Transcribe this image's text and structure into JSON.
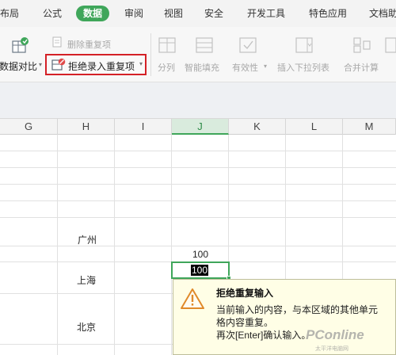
{
  "tabs": [
    "布局",
    "公式",
    "数据",
    "审阅",
    "视图",
    "安全",
    "开发工具",
    "特色应用",
    "文档助"
  ],
  "active_tab": "数据",
  "ribbon": {
    "compare_label": "数据对比",
    "remove_dup_label": "删除重复项",
    "reject_dup_label": "拒绝录入重复项",
    "split_label": "分列",
    "smart_fill_label": "智能填充",
    "validity_label": "有效性",
    "dropdown_label": "插入下拉列表",
    "merge_calc_label": "合并计算"
  },
  "columns": [
    "G",
    "H",
    "I",
    "J",
    "K",
    "L",
    "M"
  ],
  "selected_column": "J",
  "cells": {
    "guangzhou": "广州",
    "shanghai": "上海",
    "beijing": "北京",
    "j_value": "100",
    "active_value": "100"
  },
  "warning": {
    "title": "拒绝重复输入",
    "line1": "当前输入的内容，与本区域的其他单元",
    "line2": "格内容重复。",
    "line3": "再次[Enter]确认输入。"
  },
  "watermark": "PConline",
  "watermark_sub": "太平洋电脑网",
  "colors": {
    "accent": "#3fa65a",
    "highlight_border": "#d42026",
    "tooltip_bg": "#fffee6"
  }
}
